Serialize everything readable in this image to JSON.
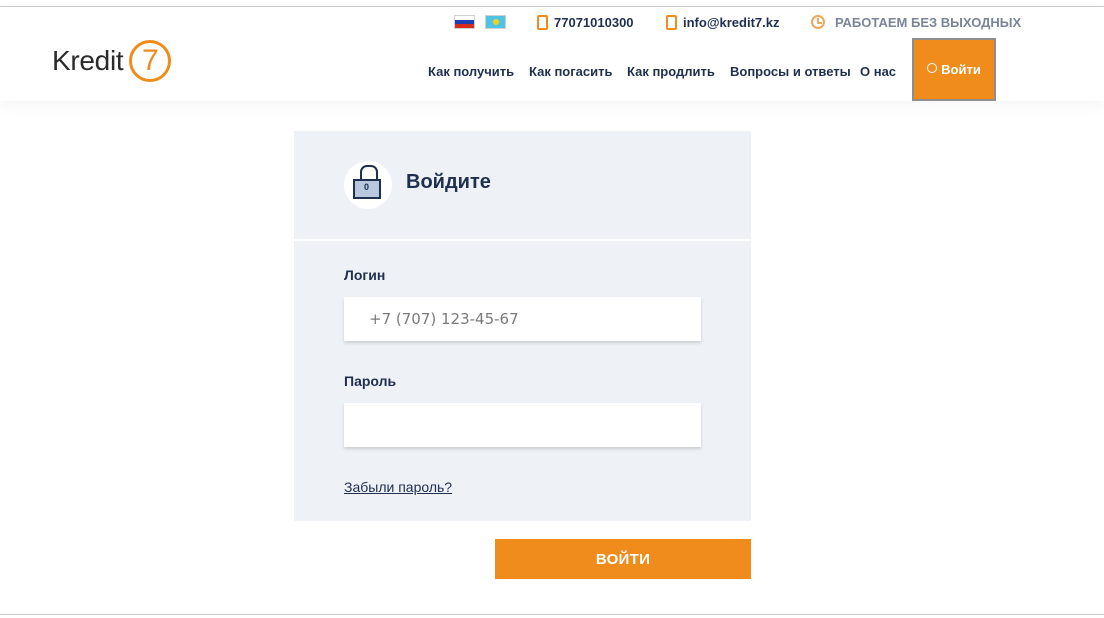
{
  "brand": {
    "logo_text": "Kredit",
    "logo_number": "7",
    "accent_color": "#f08c1b",
    "text_color": "#1f2f4f"
  },
  "topbar": {
    "languages": [
      "ru-flag-icon",
      "kz-flag-icon"
    ],
    "phone": "77071010300",
    "email": "info@kredit7.kz",
    "hours": "РАБОТАЕМ БЕЗ ВЫХОДНЫХ"
  },
  "nav": {
    "items": [
      "Как получить",
      "Как погасить",
      "Как продлить",
      "Вопросы и ответы",
      "О нас"
    ],
    "login_label": "Войти"
  },
  "form": {
    "title": "Войдите",
    "login_label": "Логин",
    "login_placeholder": "+7 (707) 123-45-67",
    "login_value": "",
    "password_label": "Пароль",
    "password_value": "",
    "forgot_link": "Забыли пароль?",
    "submit_label": "ВОЙТИ"
  }
}
